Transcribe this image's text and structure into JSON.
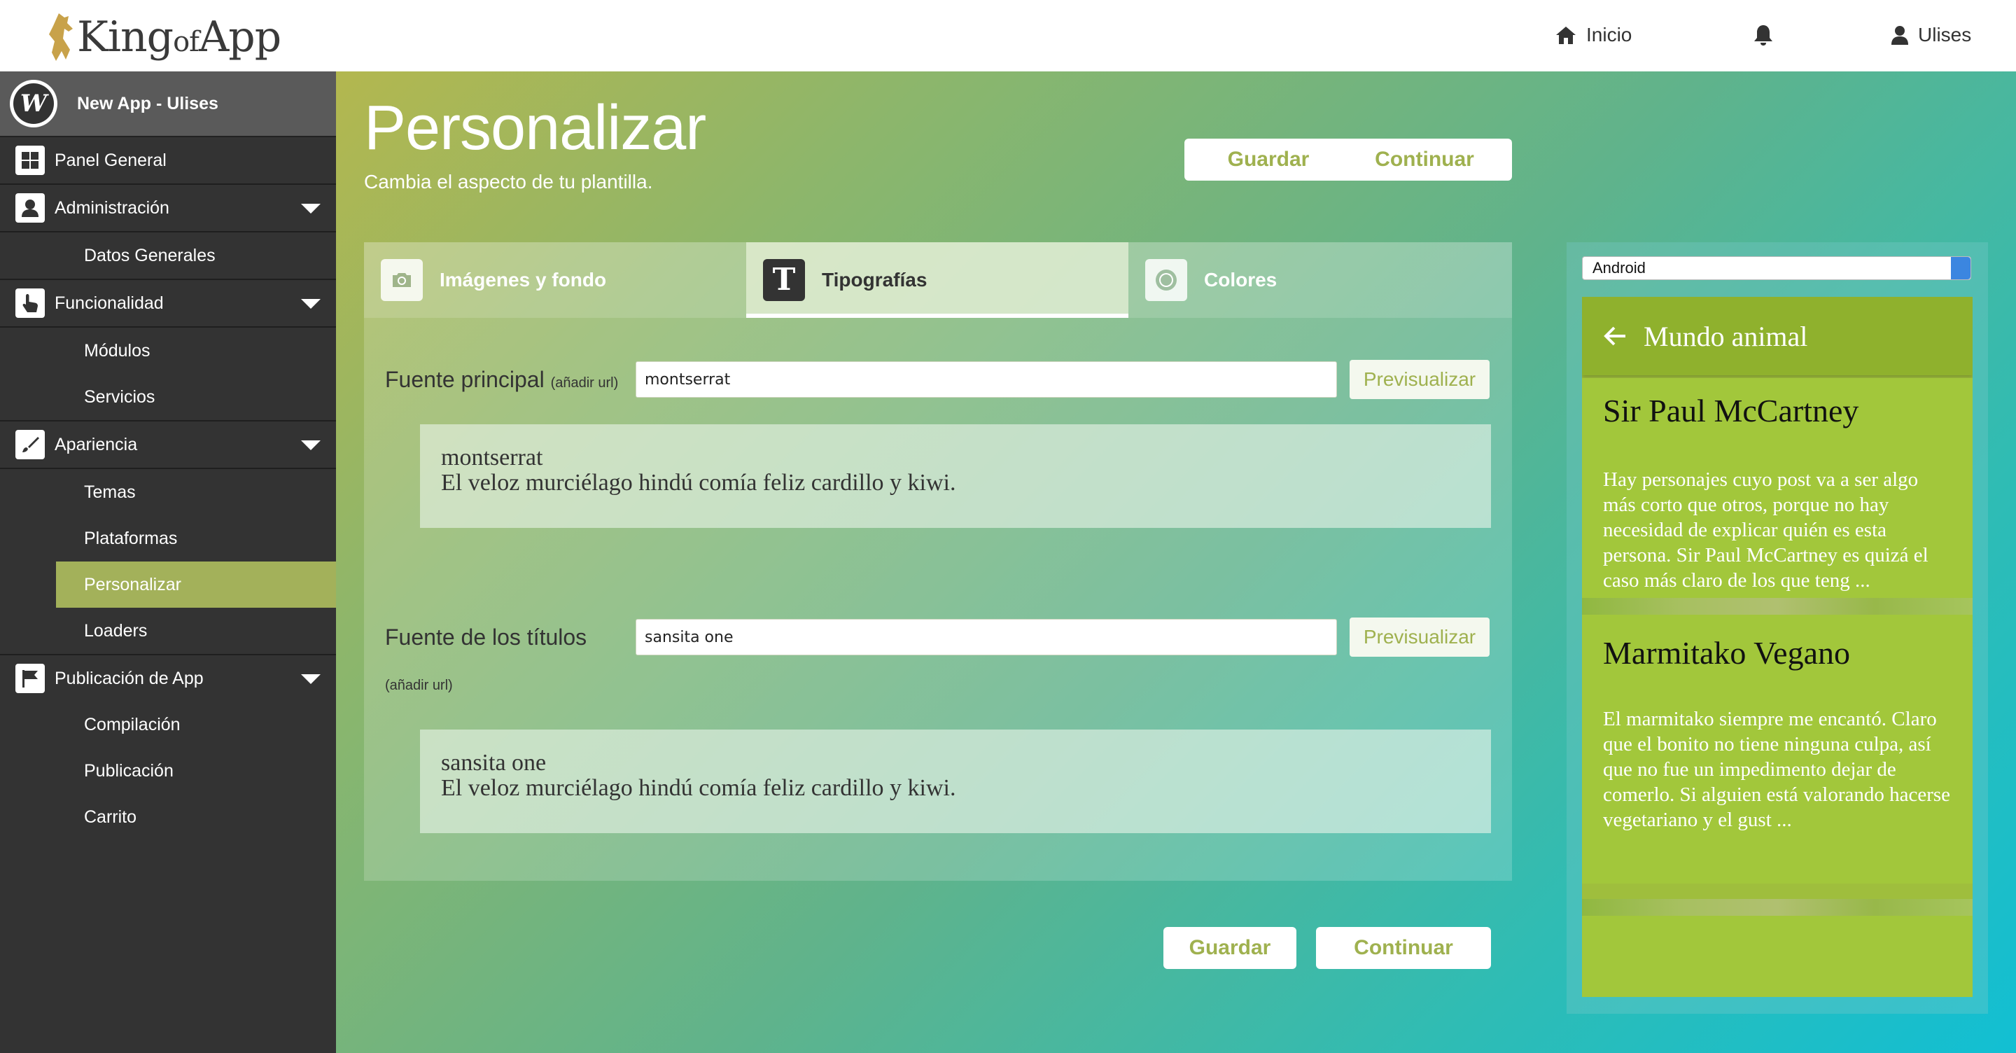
{
  "topbar": {
    "logo_text_1": "King",
    "logo_text_2": "of",
    "logo_text_3": "App",
    "nav": {
      "home_label": "Inicio",
      "user_label": "Ulises"
    }
  },
  "sidebar": {
    "app_title": "New App - Ulises",
    "panel_general": "Panel General",
    "administracion": "Administración",
    "datos_generales": "Datos Generales",
    "funcionalidad": "Funcionalidad",
    "modulos": "Módulos",
    "servicios": "Servicios",
    "apariencia": "Apariencia",
    "temas": "Temas",
    "plataformas": "Plataformas",
    "personalizar": "Personalizar",
    "loaders": "Loaders",
    "publicacion_app": "Publicación de App",
    "compilacion": "Compilación",
    "publicacion": "Publicación",
    "carrito": "Carrito"
  },
  "main": {
    "title": "Personalizar",
    "subtitle": "Cambia el aspecto de tu plantilla.",
    "save_label": "Guardar",
    "continue_label": "Continuar",
    "tabs": [
      {
        "label": "Imágenes y fondo"
      },
      {
        "label": "Tipografías"
      },
      {
        "label": "Colores"
      }
    ],
    "main_font": {
      "label": "Fuente principal",
      "hint": "(añadir url)",
      "value": "montserrat",
      "preview_button": "Previsualizar",
      "preview_name": "montserrat",
      "preview_text": "El veloz murciélago hindú comía feliz cardillo y kiwi."
    },
    "title_font": {
      "label": "Fuente de los títulos",
      "hint": "(añadir url)",
      "value": "sansita one",
      "preview_button": "Previsualizar",
      "preview_name": "sansita one",
      "preview_text": "El veloz murciélago hindú comía feliz cardillo y kiwi."
    }
  },
  "phone_preview": {
    "platform_selected": "Android",
    "app_bar_title": "Mundo animal",
    "cards": [
      {
        "title": "Sir Paul McCartney",
        "body": "Hay personajes cuyo post va a ser algo más corto que otros, porque no hay necesidad de explicar quién es esta persona. Sir Paul McCartney es quizá el caso más claro de los que teng ..."
      },
      {
        "title": "Marmitako Vegano",
        "body": "El marmitako siempre me encantó. Claro que el bonito no tiene ninguna culpa, así que no fue un impedimento dejar de comerlo. Si alguien está valorando hacerse vegetariano y el gust ..."
      }
    ]
  },
  "colors": {
    "accent": "#9fb14f",
    "sidebar_bg": "#333333",
    "sidebar_active": "#a3b15a",
    "phone_green": "#9fbe3d"
  }
}
